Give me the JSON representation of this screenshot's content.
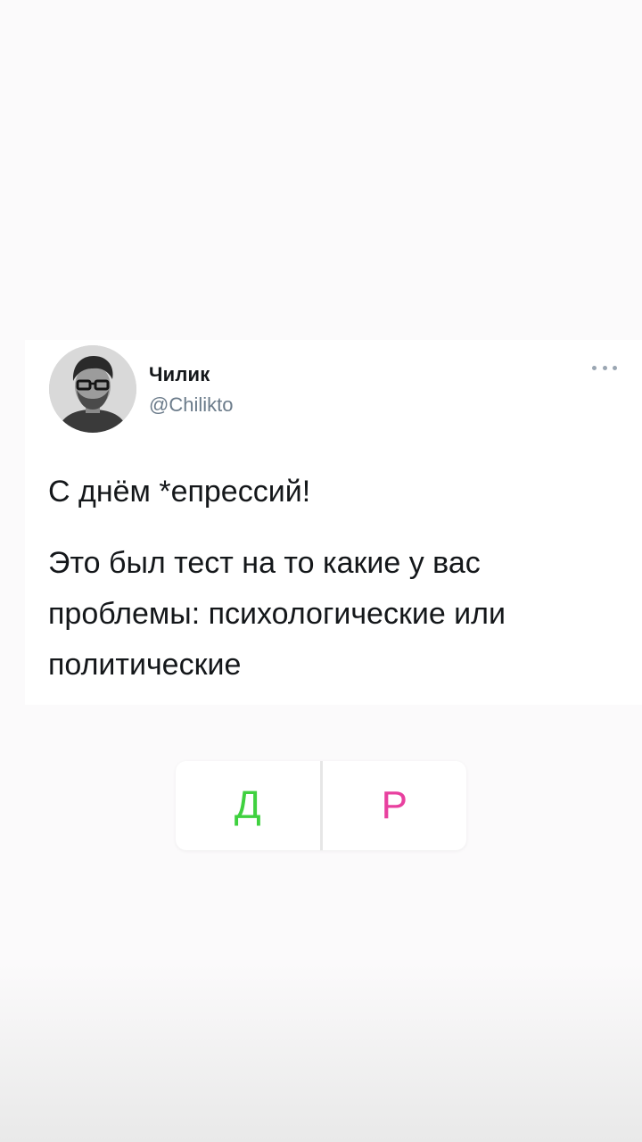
{
  "tweet": {
    "display_name": "Чилик",
    "handle": "@Chilikto",
    "text_line_1": "С днём *епрессий!",
    "text_paragraph_2": "Это был тест на то какие у вас проблемы: психологические или политические"
  },
  "quiz": {
    "option_left": "Д",
    "option_right": "Р",
    "option_left_color": "#3fd13f",
    "option_right_color": "#e8409f"
  },
  "icons": {
    "more": "more-horizontal-icon"
  }
}
